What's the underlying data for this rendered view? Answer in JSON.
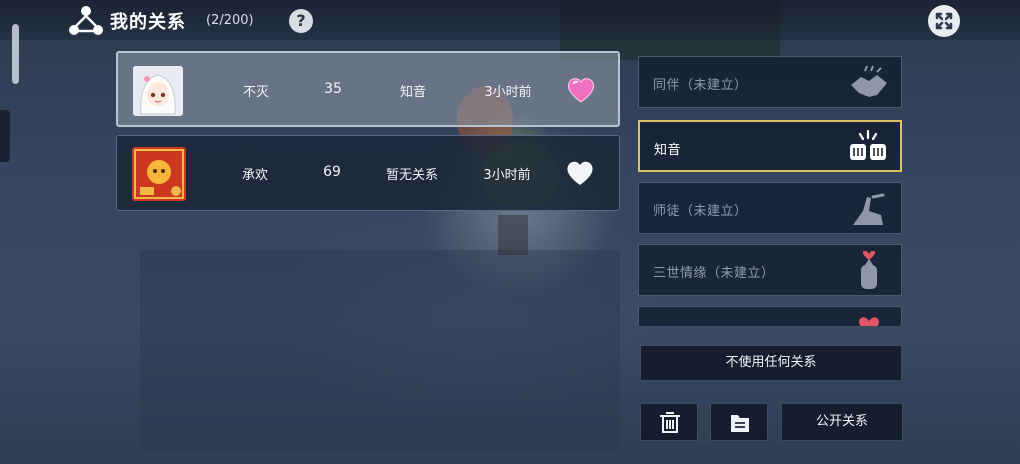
{
  "header": {
    "title": "我的关系",
    "count": "(2/200)",
    "help_glyph": "?",
    "close_glyph": "✕"
  },
  "friends": [
    {
      "name": "不灭",
      "level": "35",
      "relation": "知音",
      "last_online": "3小时前",
      "heart": "pink-heart-icon"
    },
    {
      "name": "承欢",
      "level": "69",
      "relation": "暂无关系",
      "last_online": "3小时前",
      "heart": "white-heart-icon"
    }
  ],
  "relation_types": [
    {
      "label": "同伴（未建立）",
      "icon": "handshake-icon",
      "state": "unestablished"
    },
    {
      "label": "知音",
      "icon": "fist-bump-icon",
      "state": "active"
    },
    {
      "label": "师徒（未建立）",
      "icon": "pointing-hands-icon",
      "state": "unestablished"
    },
    {
      "label": "三世情缘（未建立）",
      "icon": "finger-heart-icon",
      "state": "unestablished"
    }
  ],
  "buttons": {
    "no_relation": "不使用任何关系",
    "public": "公开关系",
    "delete_icon": "trash-icon",
    "folder_icon": "folder-icon"
  },
  "colors": {
    "active_border": "#d8c466",
    "pink_heart": "#f06fc0",
    "panel_bg": "#1a2436"
  }
}
